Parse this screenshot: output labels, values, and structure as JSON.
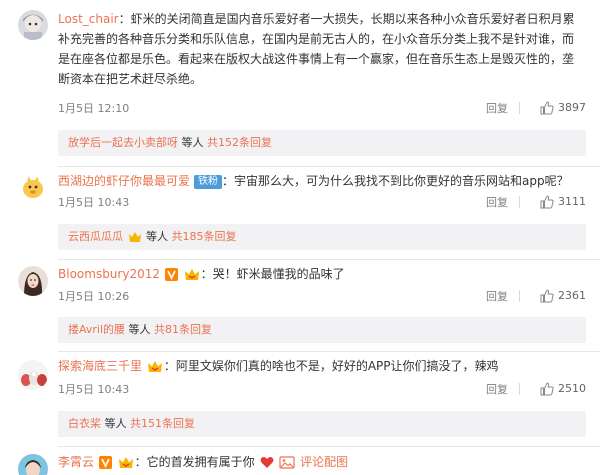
{
  "comments": [
    {
      "username": "Lost_chair",
      "text_lines": [
        "：虾米的关闭简直是国内音乐爱好者一大损失，长期以来各种小众音乐爱好者日积月累",
        "补充完善的各种音乐分类和乐队信息，在国内是前无古人的，在小众音乐分类上我不是针对谁，而",
        "是在座各位都是乐色。看起来在版权大战这件事情上有一个赢家，但在音乐生态上是毁灭性的，垄",
        "断资本在把艺术赶尽杀绝。"
      ],
      "date": "1月5日 12:10",
      "reply_label": "回复",
      "likes": "3897",
      "sub": {
        "name": "放学后一起去小卖部呀",
        "mid": " 等人 ",
        "count": "共152条回复"
      }
    },
    {
      "username": "西湖边的虾仔你最最可爱",
      "fans_badge": "铁粉",
      "text_lines": [
        "：宇宙那么大，可为什么我找不到比你更好的音乐网站和app呢？"
      ],
      "date": "1月5日 10:43",
      "reply_label": "回复",
      "likes": "3111",
      "sub": {
        "name": "云西瓜瓜瓜",
        "mid": " 等人 ",
        "count": "共185条回复"
      }
    },
    {
      "username": "Bloomsbury2012",
      "text_lines": [
        "：哭！虾米最懂我的品味了"
      ],
      "date": "1月5日 10:26",
      "reply_label": "回复",
      "likes": "2361",
      "sub": {
        "name": "搂Avril的腰",
        "mid": " 等人 ",
        "count": "共81条回复"
      }
    },
    {
      "username": "探索海底三千里",
      "text_lines": [
        "：阿里文娱你们真的啥也不是，好好的APP让你们搞没了，辣鸡"
      ],
      "date": "1月5日 10:43",
      "reply_label": "回复",
      "likes": "2510",
      "sub": {
        "name": "白衣桨",
        "mid": " 等人 ",
        "count": "共151条回复"
      }
    },
    {
      "username": "李霄云",
      "text_lines": [
        "：它的首发拥有属于你"
      ]
    }
  ],
  "colors": {
    "username": "#eb7350",
    "subbox_bg": "#f2f2f5",
    "meta": "#808080"
  }
}
